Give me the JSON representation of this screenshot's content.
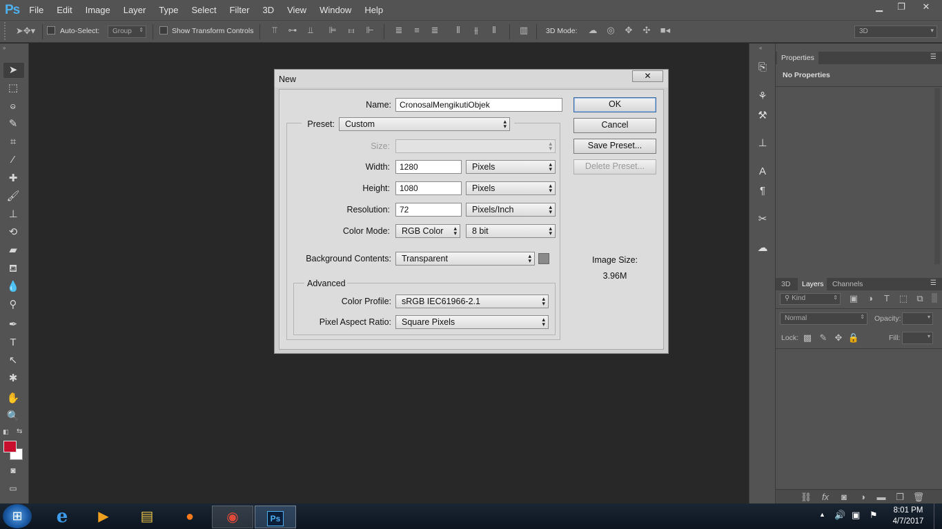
{
  "app": {
    "logo": "Ps"
  },
  "menu": [
    "File",
    "Edit",
    "Image",
    "Layer",
    "Type",
    "Select",
    "Filter",
    "3D",
    "View",
    "Window",
    "Help"
  ],
  "window_controls": {
    "minimize": "▁",
    "restore": "❐",
    "close": "✕"
  },
  "options_bar": {
    "auto_select_label": "Auto-Select:",
    "auto_select_value": "Group",
    "show_transform_label": "Show Transform Controls",
    "mode3d_label": "3D Mode:",
    "workspace_value": "3D"
  },
  "dialog": {
    "title": "New",
    "close": "✕",
    "name_label": "Name:",
    "name_value": "CronosalMengikutiObjek",
    "preset_label": "Preset:",
    "preset_value": "Custom",
    "size_label": "Size:",
    "size_value": "",
    "width_label": "Width:",
    "width_value": "1280",
    "width_unit": "Pixels",
    "height_label": "Height:",
    "height_value": "1080",
    "height_unit": "Pixels",
    "resolution_label": "Resolution:",
    "resolution_value": "72",
    "resolution_unit": "Pixels/Inch",
    "color_mode_label": "Color Mode:",
    "color_mode_value": "RGB Color",
    "bit_depth_value": "8 bit",
    "background_label": "Background Contents:",
    "background_value": "Transparent",
    "advanced_label": "Advanced",
    "color_profile_label": "Color Profile:",
    "color_profile_value": "sRGB IEC61966-2.1",
    "pixel_aspect_label": "Pixel Aspect Ratio:",
    "pixel_aspect_value": "Square Pixels",
    "ok_label": "OK",
    "cancel_label": "Cancel",
    "save_preset_label": "Save Preset...",
    "delete_preset_label": "Delete Preset...",
    "image_size_label": "Image Size:",
    "image_size_value": "3.96M"
  },
  "properties_panel": {
    "tab": "Properties",
    "content": "No Properties"
  },
  "layers_panel": {
    "tabs": [
      "3D",
      "Layers",
      "Channels"
    ],
    "kind_label": "Kind",
    "blend_mode": "Normal",
    "opacity_label": "Opacity:",
    "lock_label": "Lock:",
    "fill_label": "Fill:"
  },
  "taskbar": {
    "time": "8:01 PM",
    "date": "4/7/2017"
  },
  "colors": {
    "foreground": "#c8102e",
    "background": "#ffffff",
    "accent": "#4fb0f0"
  }
}
